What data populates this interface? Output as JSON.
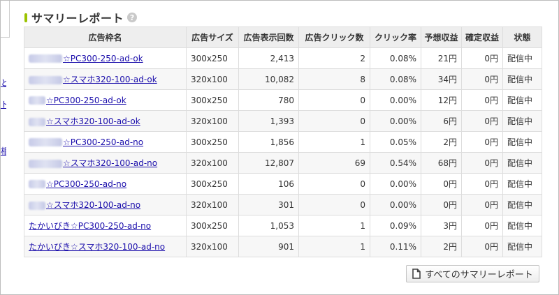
{
  "left_panel": {
    "links": [
      "と",
      "ト",
      "相"
    ]
  },
  "section": {
    "title": "サマリーレポート",
    "help_icon": "question-circle-icon"
  },
  "table": {
    "headers": [
      "広告枠名",
      "広告サイズ",
      "広告表示回数",
      "広告クリック数",
      "クリック率",
      "予想収益",
      "確定収益",
      "状態"
    ],
    "rows": [
      {
        "name_suffix": "☆PC300-250-ad-ok",
        "size": "300x250",
        "impressions": "2,413",
        "clicks": "2",
        "ctr": "0.08%",
        "estimated": "21円",
        "confirmed": "0円",
        "status": "配信中"
      },
      {
        "name_suffix": "☆スマホ320-100-ad-ok",
        "size": "320x100",
        "impressions": "10,082",
        "clicks": "8",
        "ctr": "0.08%",
        "estimated": "34円",
        "confirmed": "0円",
        "status": "配信中"
      },
      {
        "name_suffix": "☆PC300-250-ad-ok",
        "size": "300x250",
        "impressions": "780",
        "clicks": "0",
        "ctr": "0.00%",
        "estimated": "12円",
        "confirmed": "0円",
        "status": "配信中"
      },
      {
        "name_suffix": "☆スマホ320-100-ad-ok",
        "size": "320x100",
        "impressions": "1,393",
        "clicks": "0",
        "ctr": "0.00%",
        "estimated": "6円",
        "confirmed": "0円",
        "status": "配信中"
      },
      {
        "name_suffix": "☆PC300-250-ad-no",
        "size": "300x250",
        "impressions": "1,856",
        "clicks": "1",
        "ctr": "0.05%",
        "estimated": "2円",
        "confirmed": "0円",
        "status": "配信中"
      },
      {
        "name_suffix": "☆スマホ320-100-ad-no",
        "size": "320x100",
        "impressions": "12,807",
        "clicks": "69",
        "ctr": "0.54%",
        "estimated": "68円",
        "confirmed": "0円",
        "status": "配信中"
      },
      {
        "name_suffix": "☆PC300-250-ad-no",
        "size": "300x250",
        "impressions": "106",
        "clicks": "0",
        "ctr": "0.00%",
        "estimated": "0円",
        "confirmed": "0円",
        "status": "配信中"
      },
      {
        "name_suffix": "☆スマホ320-100-ad-no",
        "size": "320x100",
        "impressions": "301",
        "clicks": "0",
        "ctr": "0.00%",
        "estimated": "0円",
        "confirmed": "0円",
        "status": "配信中"
      },
      {
        "name_full": "たかいびき☆PC300-250-ad-no",
        "size": "300x250",
        "impressions": "1,053",
        "clicks": "1",
        "ctr": "0.09%",
        "estimated": "3円",
        "confirmed": "0円",
        "status": "配信中"
      },
      {
        "name_full": "たかいびき☆スマホ320-100-ad-no",
        "size": "320x100",
        "impressions": "901",
        "clicks": "1",
        "ctr": "0.11%",
        "estimated": "2円",
        "confirmed": "0円",
        "status": "配信中"
      }
    ]
  },
  "footer": {
    "all_reports_label": "すべてのサマリーレポート",
    "button_icon": "document-icon"
  },
  "colors": {
    "accent_bar": "#9bc300",
    "link": "#1a0dab",
    "header_bg": "#eeeeee",
    "border": "#dddddd"
  }
}
